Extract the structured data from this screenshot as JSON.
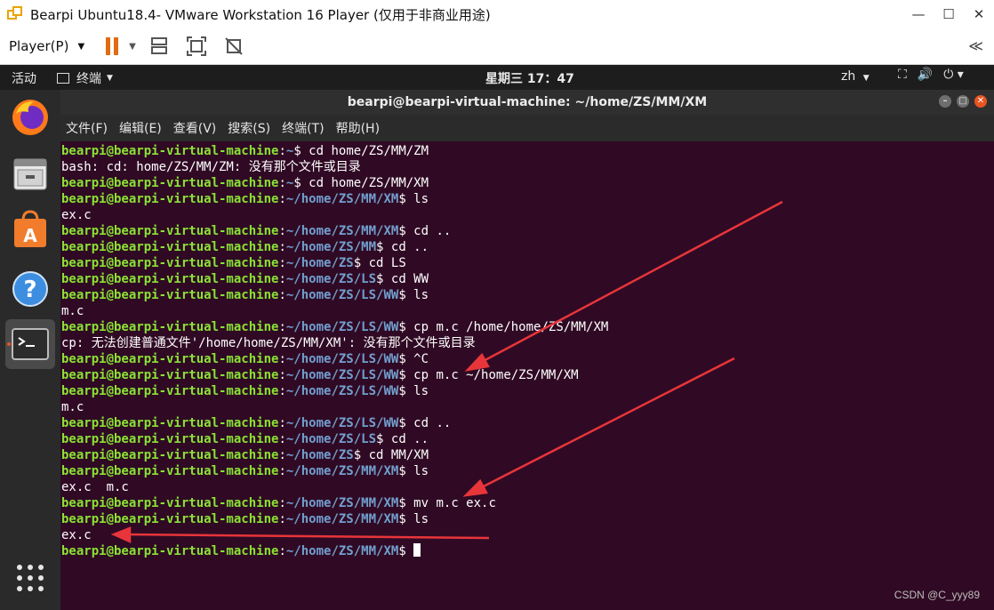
{
  "vmware": {
    "title": "Bearpi Ubuntu18.4- VMware Workstation 16 Player (仅用于非商业用途)",
    "player_menu": "Player(P)"
  },
  "ubuntu_topbar": {
    "activities": "活动",
    "app_menu": "终端",
    "clock": "星期三 17：47",
    "input_method": "zh"
  },
  "terminal": {
    "title": "bearpi@bearpi-virtual-machine: ~/home/ZS/MM/XM",
    "menu": [
      "文件(F)",
      "编辑(E)",
      "查看(V)",
      "搜索(S)",
      "终端(T)",
      "帮助(H)"
    ],
    "user_host": "bearpi@bearpi-virtual-machine",
    "lines": [
      {
        "type": "prompt",
        "path": "~",
        "cmd": " cd home/ZS/MM/ZM"
      },
      {
        "type": "output",
        "text": "bash: cd: home/ZS/MM/ZM: 没有那个文件或目录"
      },
      {
        "type": "prompt",
        "path": "~",
        "cmd": " cd home/ZS/MM/XM"
      },
      {
        "type": "prompt",
        "path": "~/home/ZS/MM/XM",
        "cmd": " ls"
      },
      {
        "type": "output",
        "text": "ex.c"
      },
      {
        "type": "prompt",
        "path": "~/home/ZS/MM/XM",
        "cmd": " cd .."
      },
      {
        "type": "prompt",
        "path": "~/home/ZS/MM",
        "cmd": " cd .."
      },
      {
        "type": "prompt",
        "path": "~/home/ZS",
        "cmd": " cd LS"
      },
      {
        "type": "prompt",
        "path": "~/home/ZS/LS",
        "cmd": " cd WW"
      },
      {
        "type": "prompt",
        "path": "~/home/ZS/LS/WW",
        "cmd": " ls"
      },
      {
        "type": "output",
        "text": "m.c"
      },
      {
        "type": "prompt",
        "path": "~/home/ZS/LS/WW",
        "cmd": " cp m.c /home/home/ZS/MM/XM"
      },
      {
        "type": "output",
        "text": "cp: 无法创建普通文件'/home/home/ZS/MM/XM': 没有那个文件或目录"
      },
      {
        "type": "prompt",
        "path": "~/home/ZS/LS/WW",
        "cmd": " ^C"
      },
      {
        "type": "prompt",
        "path": "~/home/ZS/LS/WW",
        "cmd": " cp m.c ~/home/ZS/MM/XM"
      },
      {
        "type": "prompt",
        "path": "~/home/ZS/LS/WW",
        "cmd": " ls"
      },
      {
        "type": "output",
        "text": "m.c"
      },
      {
        "type": "prompt",
        "path": "~/home/ZS/LS/WW",
        "cmd": " cd .."
      },
      {
        "type": "prompt",
        "path": "~/home/ZS/LS",
        "cmd": " cd .."
      },
      {
        "type": "prompt",
        "path": "~/home/ZS",
        "cmd": " cd MM/XM"
      },
      {
        "type": "prompt",
        "path": "~/home/ZS/MM/XM",
        "cmd": " ls"
      },
      {
        "type": "output",
        "text": "ex.c  m.c"
      },
      {
        "type": "prompt",
        "path": "~/home/ZS/MM/XM",
        "cmd": " mv m.c ex.c"
      },
      {
        "type": "prompt",
        "path": "~/home/ZS/MM/XM",
        "cmd": " ls"
      },
      {
        "type": "output",
        "text": "ex.c"
      },
      {
        "type": "prompt",
        "path": "~/home/ZS/MM/XM",
        "cmd": " ",
        "cursor": true
      }
    ]
  },
  "dock": {
    "items": [
      "firefox-icon",
      "files-icon",
      "software-center-icon",
      "help-icon",
      "terminal-icon",
      "show-apps-icon"
    ]
  },
  "watermark": "CSDN @C_yyy89",
  "colors": {
    "terminal_bg": "#300a24",
    "prompt_user": "#8ae234",
    "prompt_path": "#729fcf",
    "arrow": "#e8353a",
    "ubuntu_accent": "#e95420"
  }
}
